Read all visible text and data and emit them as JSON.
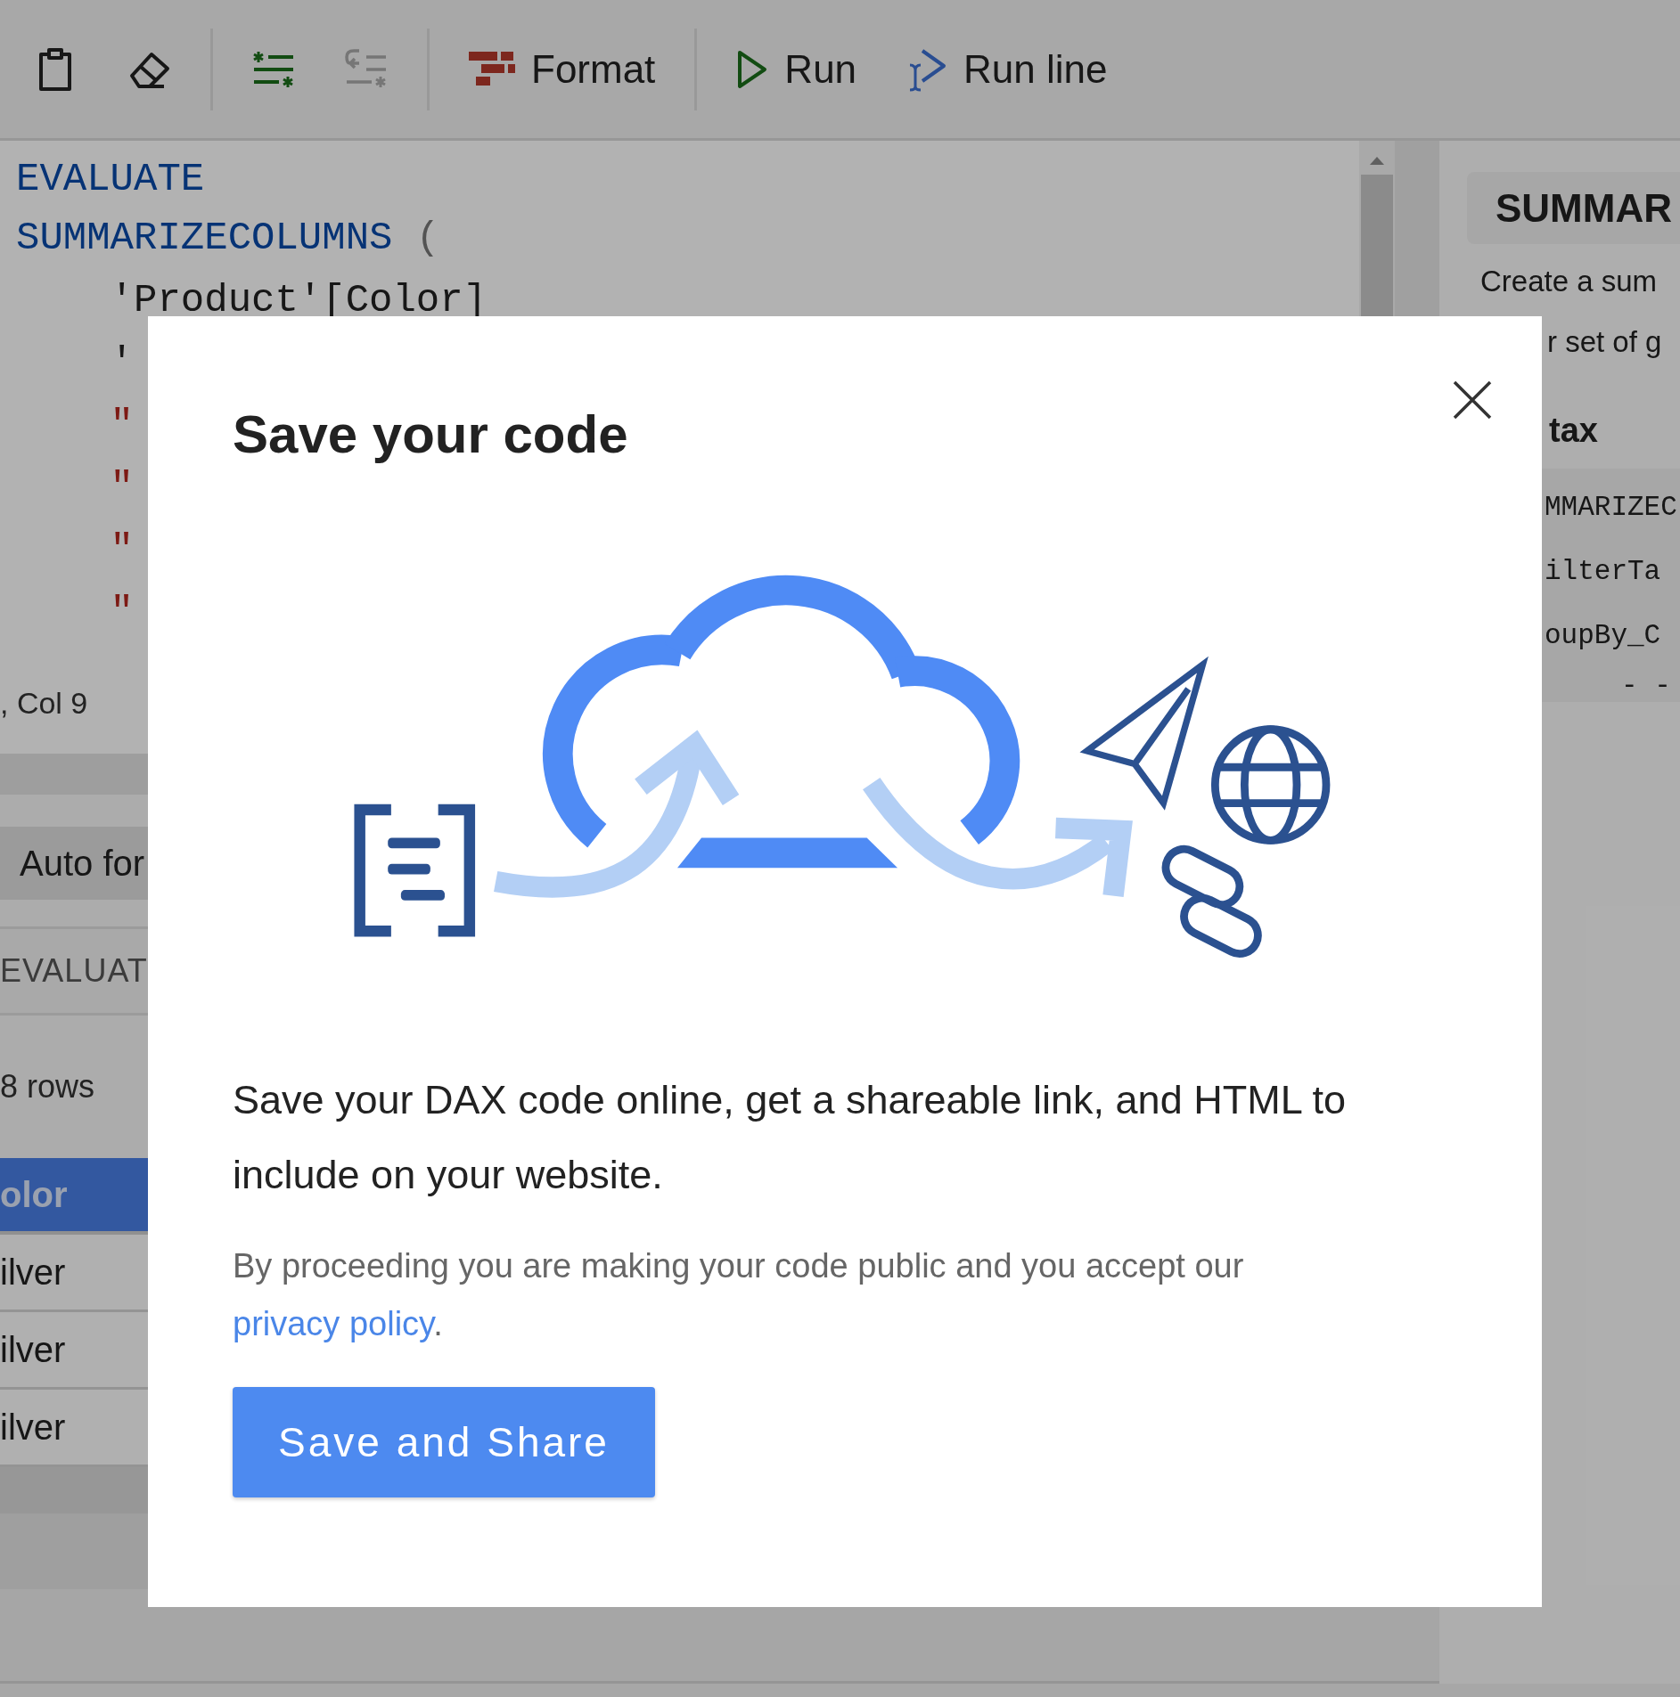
{
  "toolbar": {
    "groups": [
      [
        {
          "kind": "clipboard",
          "disabled": false
        },
        {
          "kind": "eraser",
          "disabled": false
        }
      ],
      [
        {
          "kind": "comment",
          "disabled": false
        },
        {
          "kind": "uncomment",
          "disabled": true
        }
      ],
      [
        {
          "kind": "format",
          "label": "Format",
          "disabled": false
        }
      ],
      [
        {
          "kind": "run",
          "label": "Run",
          "disabled": false
        },
        {
          "kind": "run_line",
          "label": "Run line",
          "disabled": false
        }
      ]
    ]
  },
  "editor": {
    "lines": [
      [
        {
          "text": "EVALUATE",
          "kind": "keyword"
        }
      ],
      [
        {
          "text": "SUMMARIZECOLUMNS",
          "kind": "keyword"
        },
        {
          "text": " (",
          "kind": "punct"
        }
      ],
      [
        {
          "text": "    'Product'[Color]",
          "kind": "plain"
        }
      ],
      [
        {
          "text": "    '",
          "kind": "plain"
        }
      ],
      [
        {
          "text": "    \"",
          "kind": "string"
        }
      ],
      [
        {
          "text": "    \"",
          "kind": "string"
        }
      ],
      [
        {
          "text": "    \"",
          "kind": "string"
        }
      ],
      [
        {
          "text": "    \"",
          "kind": "string"
        }
      ]
    ],
    "status": ", Col 9"
  },
  "results": {
    "auto_format": "Auto for",
    "query": "EVALUAT",
    "row_count": "8 rows",
    "column": "olor",
    "rows": [
      "ilver",
      "ilver",
      "ilver"
    ]
  },
  "help": {
    "title": "SUMMAR",
    "description": [
      "Create a sum",
      "r set of g"
    ],
    "syntax_heading": "tax",
    "syntax_lines": [
      "MMARIZEC",
      "ilterTa",
      "oupBy_C",
      "- -"
    ]
  },
  "modal": {
    "title": "Save your code",
    "description": "Save your DAX code online, get a shareable link, and HTML to include on your website.",
    "notice": "By proceeding you are making your code public and you accept our",
    "link": "privacy policy",
    "notice_end": ".",
    "button": "Save and Share"
  }
}
